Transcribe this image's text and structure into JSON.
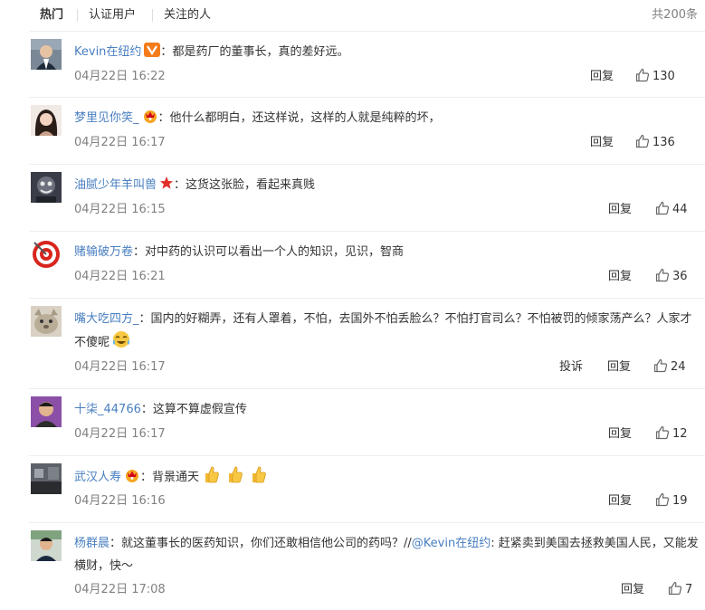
{
  "tabs": [
    {
      "label": "热门"
    },
    {
      "label": "认证用户"
    },
    {
      "label": "关注的人"
    }
  ],
  "total_label": "共200条",
  "actions": {
    "reply": "回复",
    "report": "投诉"
  },
  "icons": {
    "like": "thumbs-up-icon",
    "verified": "verified-v-icon",
    "vip_crown": "crown-icon",
    "star": "star-badge-icon"
  },
  "colors": {
    "username_orange": "#eb7350",
    "username_blue": "#4a7fc1",
    "meta_gray": "#808080"
  },
  "comments": [
    {
      "username": "Kevin在纽约",
      "badge": "verified-v-icon",
      "colon": "：",
      "text": "都是药厂的董事长，真的差好远。",
      "date": "04月22日 16:22",
      "likes": "130"
    },
    {
      "username": "梦里见你笑_",
      "badge": "crown-icon",
      "colon": "：",
      "text": "他什么都明白，还这样说，这样的人就是纯粹的坏，",
      "date": "04月22日 16:17",
      "likes": "136"
    },
    {
      "username": "油腻少年羊叫兽",
      "badge": "star-badge-icon",
      "colon": "：",
      "text": "这货这张脸，看起来真贱",
      "date": "04月22日 16:15",
      "likes": "44"
    },
    {
      "username": "赌输破万卷",
      "colon": "：",
      "text": "对中药的认识可以看出一个人的知识，见识，智商",
      "date": "04月22日 16:21",
      "likes": "36"
    },
    {
      "username": "嘴大吃四方_",
      "colon": "：",
      "text": "国内的好糊弄，还有人罩着，不怕，去国外不怕丢脸么？不怕打官司么？不怕被罚的倾家荡产么？人家才不傻呢",
      "date": "04月22日 16:17",
      "likes": "24"
    },
    {
      "username": "十柒_44766",
      "colon": "：",
      "text": "这算不算虚假宣传",
      "date": "04月22日 16:17",
      "likes": "12"
    },
    {
      "username": "武汉人寿",
      "badge": "crown-icon",
      "colon": "：",
      "text": "背景通天",
      "date": "04月22日 16:16",
      "likes": "19"
    },
    {
      "username": "杨群晨",
      "colon": "：",
      "text": "就这董事长的医药知识，你们还敢相信他公司的药吗？//",
      "mention": "@Kevin在纽约",
      "text2": ": 赶紧卖到美国去拯救美国人民，又能发横财，快～",
      "date": "04月22日 17:08",
      "likes": "7"
    }
  ]
}
